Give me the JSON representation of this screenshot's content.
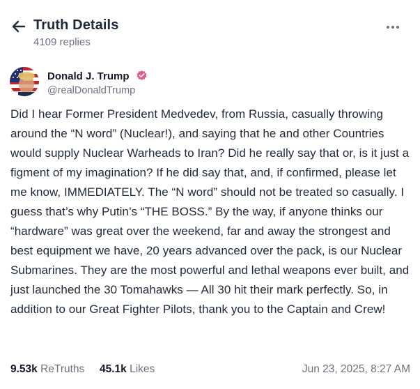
{
  "header": {
    "title": "Truth Details",
    "replies": "4109 replies"
  },
  "author": {
    "display_name": "Donald J. Trump",
    "handle": "@realDonaldTrump",
    "verified": true,
    "verified_color": "#e45b8f"
  },
  "post": {
    "text": "Did I hear Former President Medvedev, from Russia, casually throwing around the “N word” (Nuclear!), and saying that he and other Countries would supply Nuclear Warheads to Iran? Did he really say that or, is it just a figment of my imagination? If he did say that, and, if confirmed, please let me know, IMMEDIATELY. The “N word” should not be treated so casually. I guess that’s why Putin’s “THE BOSS.” By the way, if anyone thinks our “hardware” was great over the weekend, far and away the strongest and best equipment we have, 20 years advanced over the pack, is our Nuclear Submarines. They are the most powerful and lethal weapons ever built, and just launched the 30 Tomahawks — All 30 hit their mark perfectly. So, in addition to our Great Fighter Pilots, thank you to the Captain and Crew!"
  },
  "stats": {
    "retruths_count": "9.53k",
    "retruths_label": "ReTruths",
    "likes_count": "45.1k",
    "likes_label": "Likes",
    "timestamp": "Jun 23, 2025, 8:27 AM"
  },
  "icons": {
    "back": "arrow-left-icon",
    "more": "more-horizontal-icon",
    "verified": "verified-badge-icon"
  }
}
